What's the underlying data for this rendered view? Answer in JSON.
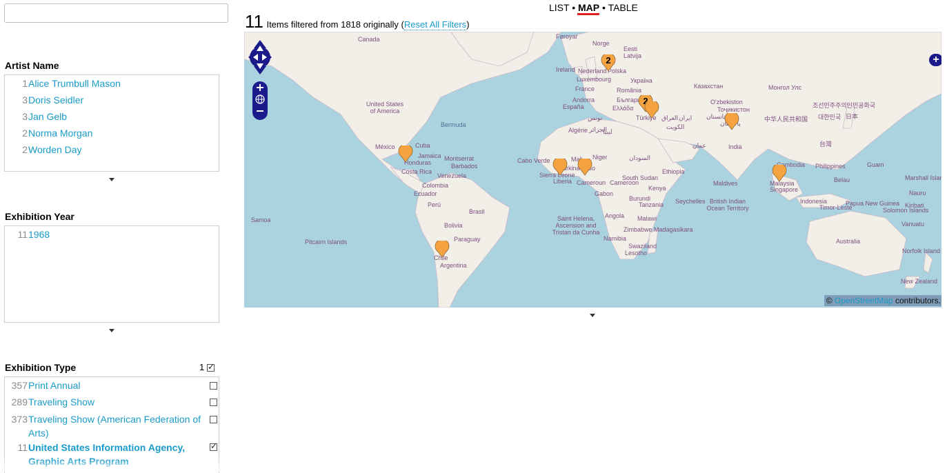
{
  "search": {
    "value": "",
    "placeholder": ""
  },
  "facets": {
    "artist": {
      "title": "Artist Name",
      "items": [
        {
          "count": "1",
          "label": "Alice Trumbull Mason"
        },
        {
          "count": "3",
          "label": "Doris Seidler"
        },
        {
          "count": "3",
          "label": "Jan Gelb"
        },
        {
          "count": "2",
          "label": "Norma Morgan"
        },
        {
          "count": "2",
          "label": "Worden Day"
        }
      ]
    },
    "year": {
      "title": "Exhibition Year",
      "items": [
        {
          "count": "11",
          "label": "1968"
        }
      ]
    },
    "type": {
      "title": "Exhibition Type",
      "selected_count": "1",
      "items": [
        {
          "count": "357",
          "label": "Print Annual",
          "checked": false
        },
        {
          "count": "289",
          "label": "Traveling Show",
          "checked": false
        },
        {
          "count": "373",
          "label_line1": "Traveling Show (American Federation of",
          "label_line2": "Arts)",
          "checked": false
        },
        {
          "count": "11",
          "label_line1": "United States Information Agency,",
          "label_line2": "Graphic Arts Program",
          "checked": true
        }
      ]
    }
  },
  "views": {
    "list": "LIST",
    "map": "MAP",
    "table": "TABLE",
    "separator": "•",
    "active": "MAP"
  },
  "summary": {
    "count": "11",
    "text": "Items filtered from 1818 originally (",
    "reset": "Reset All Filters",
    "close": ")"
  },
  "map": {
    "attribution": {
      "prefix": "©",
      "link": "OpenStreetMap",
      "suffix": "contributors."
    },
    "marker_color": "#f4a340",
    "water_color": "#aad3df",
    "land_color": "#f2efe9",
    "clusters": [
      "2",
      "2"
    ],
    "labels": [
      "Canada",
      "Føroyar",
      "Norge",
      "Eesti",
      "Latvija",
      "Ireland",
      "Nederland",
      "Polska",
      "Luxembourg",
      "France",
      "România",
      "Україна",
      "Казахстан",
      "Монгол Улс",
      "United States of America",
      "Andorra",
      "España",
      "България",
      "Ελλάδα",
      "Türkiye",
      "O'zbekiston",
      "Тоҷикистон",
      "조선민주주의인민공화국",
      "대한민국",
      "日本",
      "Bermuda",
      "تونس",
      "Algérie",
      "الجزائر",
      "ایران",
      "العراق",
      "الكويت",
      "افغانستان",
      "پاکستان",
      "中华人民共和国",
      "México",
      "Cuba",
      "Jamaica",
      "Honduras",
      "Montserrat",
      "Barbados",
      "Costa Rica",
      "Venezuela",
      "Colombia",
      "Ecuador",
      "Perú",
      "Brasil",
      "Bolivia",
      "Paraguay",
      "Chile",
      "Argentina",
      "Pitcairn Islands",
      "Cabo Verde",
      "Mali",
      "Niger",
      "Burkina Faso",
      "Sierra Leone",
      "Liberia",
      "Cameroun",
      "Cameroon",
      "South Sudan",
      "السودان",
      "Ethiopia",
      "Kenya",
      "Gabon",
      "Burundi",
      "Tanzania",
      "Angola",
      "Malawi",
      "Zimbabwe",
      "Madagasikara",
      "Namibia",
      "Swaziland",
      "Lesotho",
      "Saint Helena, Ascension and Tristan da Cunha",
      "Seychelles",
      "British Indian Ocean Territory",
      "India",
      "Maldives",
      "Cambodia",
      "Malaysia",
      "Singapore",
      "Philippines",
      "Guam",
      "Belau",
      "Indonesia",
      "Timor-Leste",
      "Papua New Guinea",
      "Solomon Islands",
      "Vanuatu",
      "Australia",
      "Marshall Islands",
      "Nauru",
      "Kiribati",
      "Norfolk Island",
      "New Zealand",
      "台灣",
      "عمان",
      "ليبيا",
      "Samoa"
    ]
  }
}
